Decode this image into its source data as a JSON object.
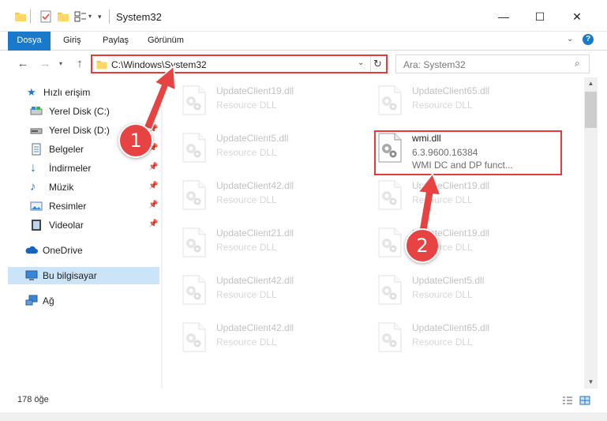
{
  "window": {
    "title": "System32",
    "controls": {
      "minimize_icon": "minimize-icon",
      "maximize_icon": "maximize-icon",
      "close_icon": "close-icon"
    }
  },
  "ribbon": {
    "tabs": [
      {
        "label": "Dosya"
      },
      {
        "label": "Giriş"
      },
      {
        "label": "Paylaş"
      },
      {
        "label": "Görünüm"
      }
    ]
  },
  "address": {
    "path": "C:\\Windows\\System32",
    "search_placeholder": "Ara: System32"
  },
  "navpane": {
    "items": [
      {
        "label": "Hızlı erişim",
        "icon": "star-icon",
        "pinned": false
      },
      {
        "label": "Yerel Disk (C:)",
        "icon": "drive-icon",
        "pinned": true
      },
      {
        "label": "Yerel Disk (D:)",
        "icon": "drive-icon",
        "pinned": true
      },
      {
        "label": "Belgeler",
        "icon": "documents-icon",
        "pinned": true
      },
      {
        "label": "İndirmeler",
        "icon": "download-icon",
        "pinned": true
      },
      {
        "label": "Müzik",
        "icon": "music-icon",
        "pinned": true
      },
      {
        "label": "Resimler",
        "icon": "pictures-icon",
        "pinned": true
      },
      {
        "label": "Videolar",
        "icon": "video-icon",
        "pinned": true
      },
      {
        "label": "OneDrive",
        "icon": "cloud-icon",
        "pinned": false
      },
      {
        "label": "Bu bilgisayar",
        "icon": "computer-icon",
        "pinned": false,
        "selected": true
      },
      {
        "label": "Ağ",
        "icon": "network-icon",
        "pinned": false
      }
    ]
  },
  "files": {
    "left": [
      {
        "name": "UpdateClient19.dll",
        "desc": "Resource DLL"
      },
      {
        "name": "UpdateClient5.dll",
        "desc": "Resource DLL"
      },
      {
        "name": "UpdateClient42.dll",
        "desc": "Resource DLL"
      },
      {
        "name": "UpdateClient21.dll",
        "desc": "Resource DLL"
      },
      {
        "name": "UpdateClient42.dll",
        "desc": "Resource DLL"
      },
      {
        "name": "UpdateClient42.dll",
        "desc": "Resource DLL"
      }
    ],
    "right": [
      {
        "name": "UpdateClient65.dll",
        "desc": "Resource DLL"
      },
      {
        "name": "wmi.dll",
        "version": "6.3.9600.16384",
        "desc": "WMI DC and DP funct..."
      },
      {
        "name": "UpdateClient19.dll",
        "desc": "Resource DLL"
      },
      {
        "name": "UpdateClient19.dll",
        "desc": "Resource DLL"
      },
      {
        "name": "UpdateClient5.dll",
        "desc": "Resource DLL"
      },
      {
        "name": "UpdateClient65.dll",
        "desc": "Resource DLL"
      }
    ]
  },
  "status": {
    "count_text": "178 öğe"
  },
  "annotations": [
    {
      "number": "1"
    },
    {
      "number": "2"
    }
  ],
  "colors": {
    "accent": "#1979ca",
    "highlight": "#e63a3a",
    "selected": "#cce4f7"
  }
}
